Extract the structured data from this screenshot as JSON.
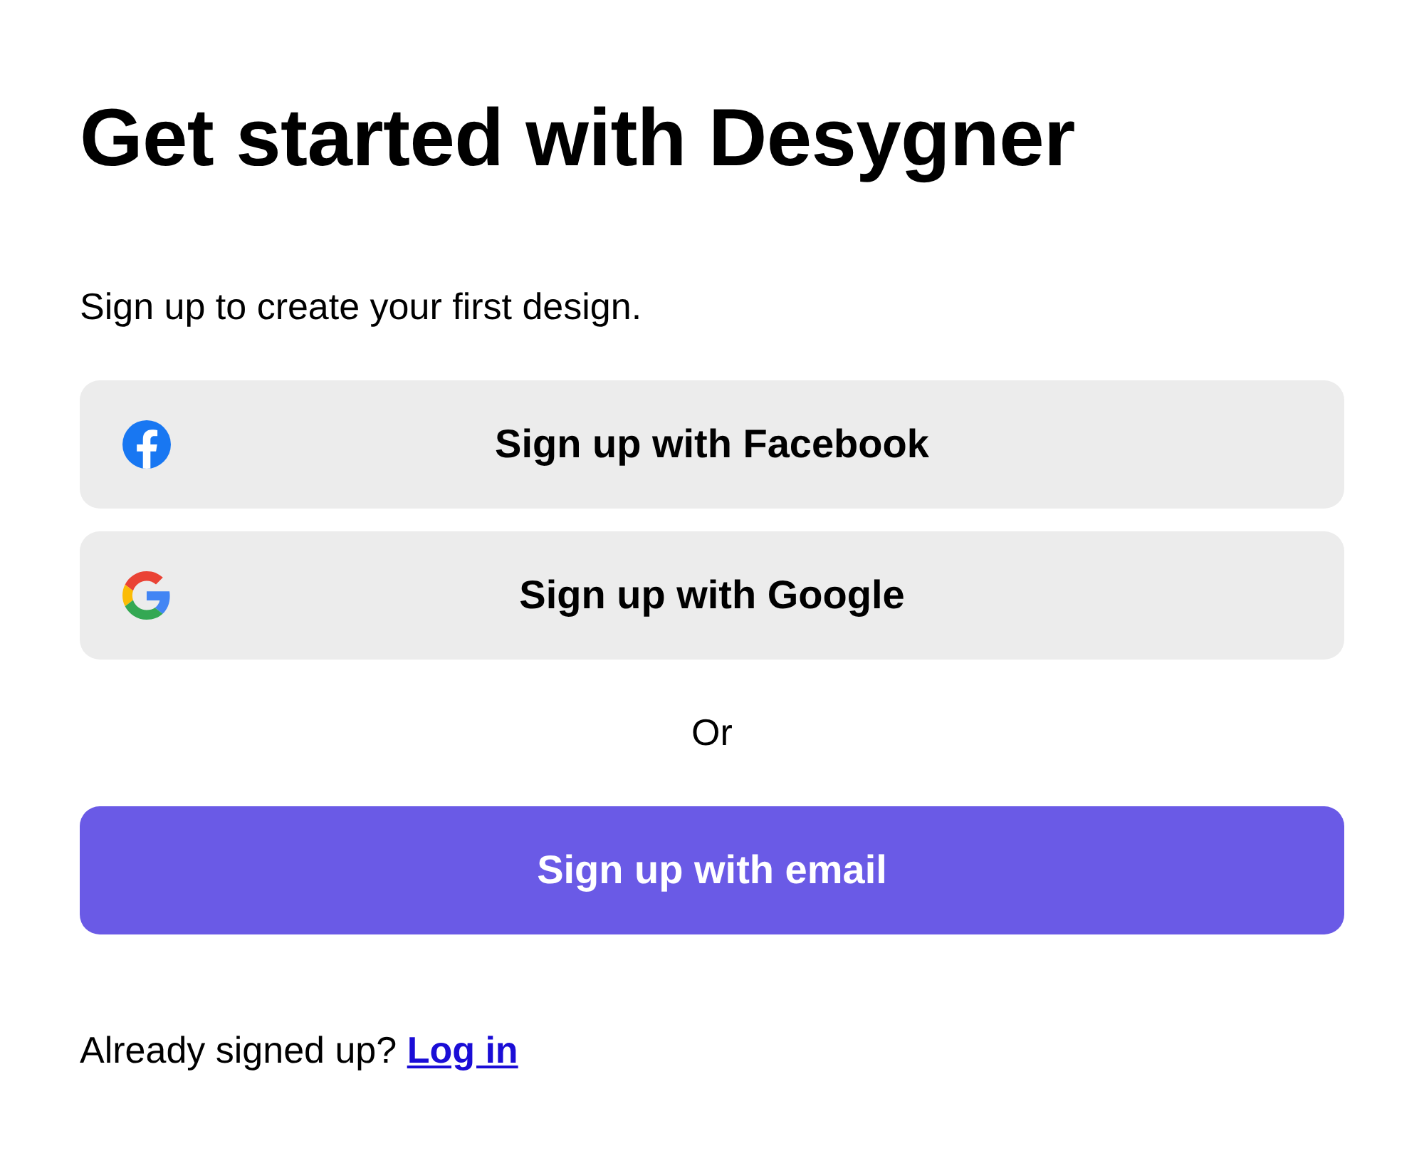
{
  "heading": "Get started with Desygner",
  "subtitle": "Sign up to create your first design.",
  "social_buttons": [
    {
      "kind": "facebook",
      "label": "Sign up with Facebook"
    },
    {
      "kind": "google",
      "label": "Sign up with Google"
    }
  ],
  "divider_text": "Or",
  "email_button": {
    "label": "Sign up with email"
  },
  "login_prompt": {
    "text": "Already signed up?",
    "link": "Log in"
  }
}
